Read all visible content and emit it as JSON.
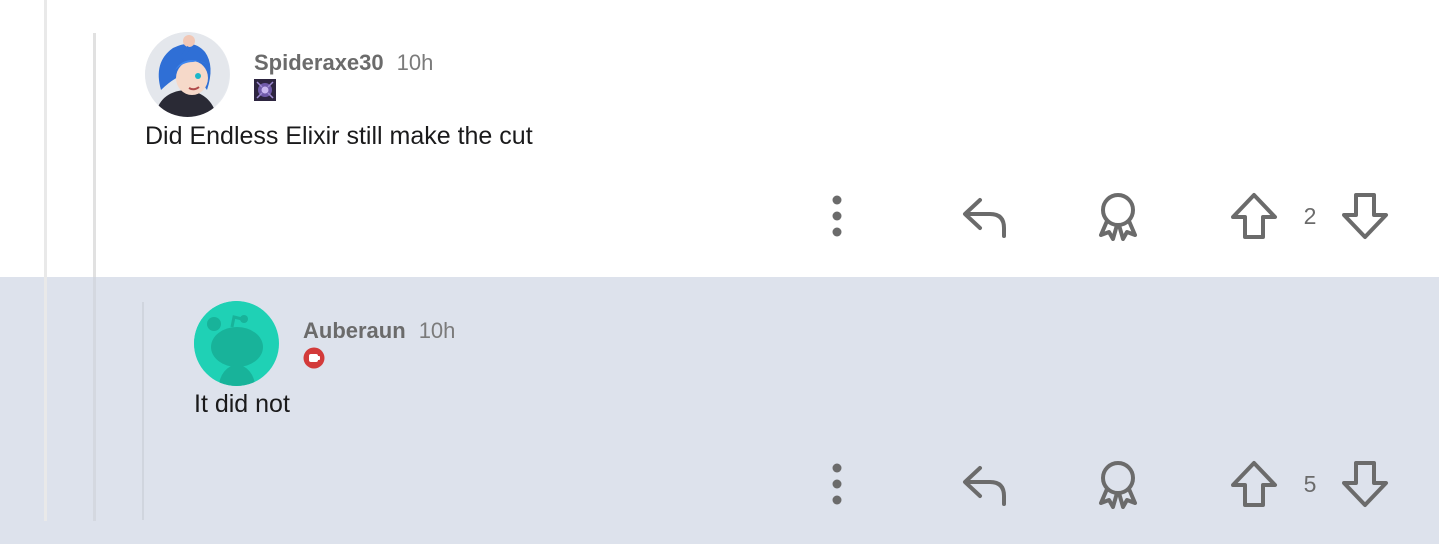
{
  "comments": [
    {
      "username": "Spideraxe30",
      "time": "10h",
      "text": "Did Endless Elixir still make the cut",
      "score": "2",
      "avatar": "blue-haired-character-avatar",
      "flair_icon": "purple-emblem-icon"
    },
    {
      "username": "Auberaun",
      "time": "10h",
      "text": "It did not",
      "score": "5",
      "avatar": "default-snoo-avatar",
      "flair_icon": "red-fist-badge-icon"
    }
  ],
  "colors": {
    "highlight_bg": "#dde2ec",
    "icon_gray": "#6b6b6b",
    "snoo_teal": "#1fd1b5",
    "badge_red": "#d33a3a"
  }
}
